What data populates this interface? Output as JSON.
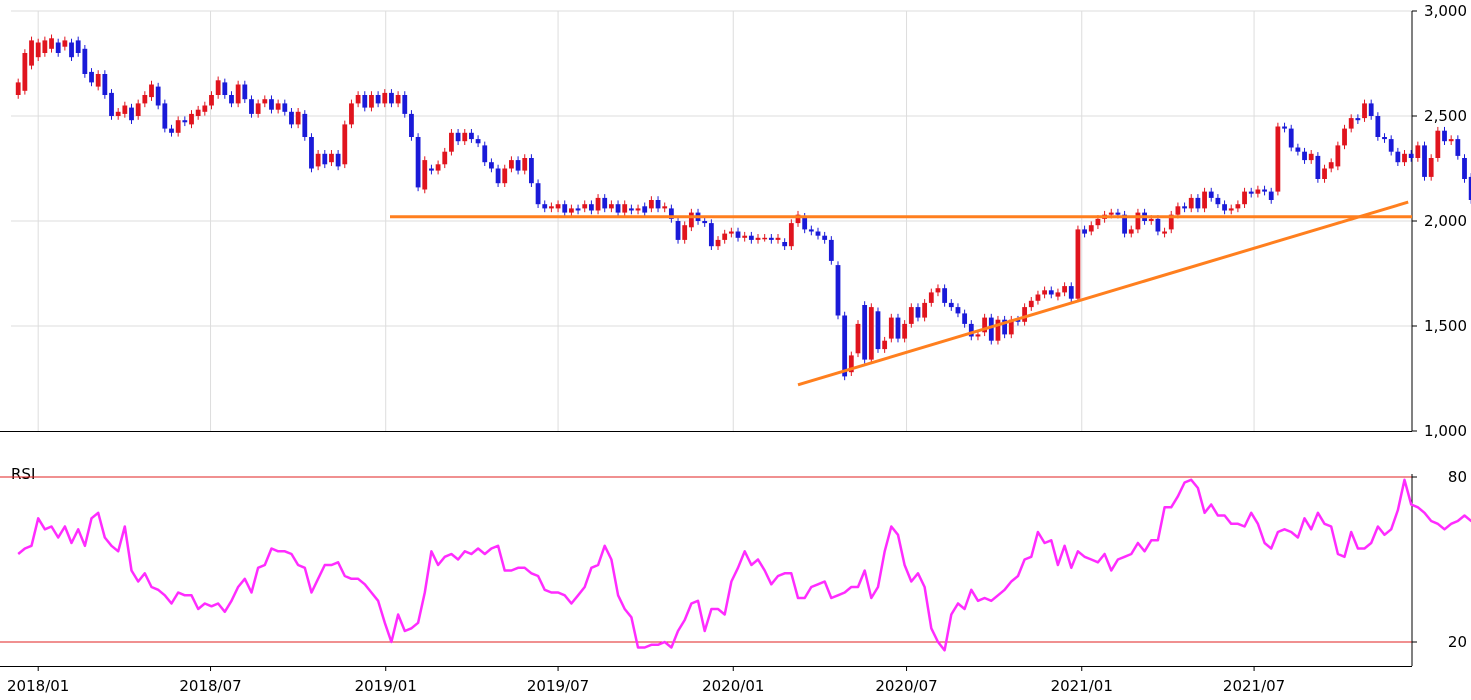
{
  "chart_data": [
    {
      "type": "candlestick",
      "ylim": [
        1000,
        3000
      ],
      "yticks": [
        "3,000",
        "2,500",
        "2,000",
        "1,500",
        "1,000"
      ],
      "ytick_values": [
        3000,
        2500,
        2000,
        1500,
        1000
      ],
      "xticks": [
        "2018/01",
        "2018/07",
        "2019/01",
        "2019/07",
        "2020/01",
        "2020/07",
        "2021/01",
        "2021/07"
      ],
      "grid": true,
      "colors": {
        "up": "#e0141e",
        "down": "#1a1ad8",
        "trend": "#ff7f1e",
        "marker": "#3b3bb0"
      },
      "start_date": "2017-12-11",
      "period": "weekly",
      "candles": [
        [
          2600,
          2660
        ],
        [
          2620,
          2800
        ],
        [
          2740,
          2860
        ],
        [
          2780,
          2850
        ],
        [
          2800,
          2860
        ],
        [
          2820,
          2870
        ],
        [
          2850,
          2800
        ],
        [
          2830,
          2860
        ],
        [
          2850,
          2780
        ],
        [
          2860,
          2800
        ],
        [
          2820,
          2700
        ],
        [
          2710,
          2660
        ],
        [
          2640,
          2700
        ],
        [
          2700,
          2600
        ],
        [
          2610,
          2500
        ],
        [
          2500,
          2520
        ],
        [
          2510,
          2550
        ],
        [
          2540,
          2480
        ],
        [
          2500,
          2560
        ],
        [
          2560,
          2600
        ],
        [
          2590,
          2650
        ],
        [
          2640,
          2550
        ],
        [
          2560,
          2440
        ],
        [
          2440,
          2420
        ],
        [
          2420,
          2480
        ],
        [
          2480,
          2470
        ],
        [
          2460,
          2510
        ],
        [
          2500,
          2530
        ],
        [
          2520,
          2550
        ],
        [
          2550,
          2600
        ],
        [
          2600,
          2670
        ],
        [
          2660,
          2600
        ],
        [
          2600,
          2560
        ],
        [
          2560,
          2650
        ],
        [
          2650,
          2580
        ],
        [
          2580,
          2510
        ],
        [
          2510,
          2560
        ],
        [
          2560,
          2580
        ],
        [
          2580,
          2530
        ],
        [
          2530,
          2560
        ],
        [
          2560,
          2520
        ],
        [
          2520,
          2460
        ],
        [
          2460,
          2520
        ],
        [
          2510,
          2400
        ],
        [
          2400,
          2250
        ],
        [
          2260,
          2320
        ],
        [
          2320,
          2270
        ],
        [
          2280,
          2320
        ],
        [
          2320,
          2260
        ],
        [
          2270,
          2460
        ],
        [
          2460,
          2560
        ],
        [
          2560,
          2600
        ],
        [
          2600,
          2540
        ],
        [
          2540,
          2600
        ],
        [
          2600,
          2560
        ],
        [
          2560,
          2610
        ],
        [
          2610,
          2560
        ],
        [
          2560,
          2600
        ],
        [
          2600,
          2510
        ],
        [
          2510,
          2400
        ],
        [
          2400,
          2160
        ],
        [
          2150,
          2290
        ],
        [
          2250,
          2240
        ],
        [
          2240,
          2270
        ],
        [
          2270,
          2330
        ],
        [
          2330,
          2420
        ],
        [
          2420,
          2380
        ],
        [
          2380,
          2420
        ],
        [
          2420,
          2390
        ],
        [
          2390,
          2370
        ],
        [
          2360,
          2280
        ],
        [
          2280,
          2250
        ],
        [
          2250,
          2180
        ],
        [
          2180,
          2250
        ],
        [
          2250,
          2290
        ],
        [
          2290,
          2240
        ],
        [
          2240,
          2300
        ],
        [
          2300,
          2180
        ],
        [
          2180,
          2080
        ],
        [
          2080,
          2060
        ],
        [
          2060,
          2070
        ],
        [
          2060,
          2080
        ],
        [
          2080,
          2040
        ],
        [
          2040,
          2060
        ],
        [
          2060,
          2050
        ],
        [
          2060,
          2080
        ],
        [
          2080,
          2050
        ],
        [
          2050,
          2110
        ],
        [
          2110,
          2060
        ],
        [
          2060,
          2080
        ],
        [
          2080,
          2040
        ],
        [
          2040,
          2080
        ],
        [
          2060,
          2050
        ],
        [
          2050,
          2060
        ],
        [
          2070,
          2040
        ],
        [
          2060,
          2100
        ],
        [
          2100,
          2060
        ],
        [
          2060,
          2070
        ],
        [
          2060,
          2010
        ],
        [
          2000,
          1910
        ],
        [
          1910,
          1980
        ],
        [
          1970,
          2040
        ],
        [
          2040,
          2000
        ],
        [
          2000,
          1990
        ],
        [
          1990,
          1880
        ],
        [
          1880,
          1910
        ],
        [
          1910,
          1940
        ],
        [
          1940,
          1950
        ],
        [
          1950,
          1920
        ],
        [
          1920,
          1930
        ],
        [
          1930,
          1910
        ],
        [
          1910,
          1920
        ],
        [
          1920,
          1920
        ],
        [
          1920,
          1910
        ],
        [
          1910,
          1920
        ],
        [
          1900,
          1880
        ],
        [
          1880,
          1990
        ],
        [
          1990,
          2030
        ],
        [
          2020,
          1960
        ],
        [
          1960,
          1950
        ],
        [
          1950,
          1930
        ],
        [
          1930,
          1910
        ],
        [
          1910,
          1810
        ],
        [
          1790,
          1550
        ],
        [
          1550,
          1260
        ],
        [
          1280,
          1360
        ],
        [
          1370,
          1510
        ],
        [
          1600,
          1340
        ],
        [
          1340,
          1590
        ],
        [
          1570,
          1390
        ],
        [
          1390,
          1430
        ],
        [
          1440,
          1540
        ],
        [
          1540,
          1440
        ],
        [
          1440,
          1510
        ],
        [
          1510,
          1590
        ],
        [
          1590,
          1540
        ],
        [
          1540,
          1610
        ],
        [
          1610,
          1660
        ],
        [
          1660,
          1680
        ],
        [
          1680,
          1610
        ],
        [
          1610,
          1590
        ],
        [
          1590,
          1560
        ],
        [
          1560,
          1510
        ],
        [
          1510,
          1450
        ],
        [
          1450,
          1460
        ],
        [
          1470,
          1540
        ],
        [
          1540,
          1430
        ],
        [
          1430,
          1530
        ],
        [
          1530,
          1460
        ],
        [
          1460,
          1530
        ],
        [
          1530,
          1520
        ],
        [
          1520,
          1590
        ],
        [
          1590,
          1620
        ],
        [
          1620,
          1650
        ],
        [
          1650,
          1670
        ],
        [
          1670,
          1650
        ],
        [
          1640,
          1660
        ],
        [
          1660,
          1690
        ],
        [
          1690,
          1630
        ],
        [
          1630,
          1960
        ],
        [
          1960,
          1940
        ],
        [
          1950,
          1980
        ],
        [
          1980,
          2010
        ],
        [
          2010,
          2030
        ],
        [
          2030,
          2040
        ],
        [
          2040,
          2030
        ],
        [
          2030,
          1940
        ],
        [
          1940,
          1960
        ],
        [
          1960,
          2040
        ],
        [
          2040,
          2000
        ],
        [
          2000,
          2010
        ],
        [
          2010,
          1950
        ],
        [
          1940,
          1950
        ],
        [
          1960,
          2030
        ],
        [
          2030,
          2070
        ],
        [
          2070,
          2060
        ],
        [
          2060,
          2110
        ],
        [
          2110,
          2060
        ],
        [
          2060,
          2140
        ],
        [
          2140,
          2110
        ],
        [
          2110,
          2080
        ],
        [
          2080,
          2050
        ],
        [
          2050,
          2060
        ],
        [
          2060,
          2080
        ],
        [
          2080,
          2140
        ],
        [
          2140,
          2130
        ],
        [
          2130,
          2150
        ],
        [
          2150,
          2140
        ],
        [
          2140,
          2100
        ],
        [
          2140,
          2450
        ],
        [
          2450,
          2440
        ],
        [
          2440,
          2350
        ],
        [
          2350,
          2330
        ],
        [
          2330,
          2290
        ],
        [
          2290,
          2320
        ],
        [
          2310,
          2200
        ],
        [
          2200,
          2250
        ],
        [
          2250,
          2280
        ],
        [
          2260,
          2360
        ],
        [
          2360,
          2440
        ],
        [
          2440,
          2490
        ],
        [
          2490,
          2480
        ],
        [
          2490,
          2560
        ],
        [
          2560,
          2500
        ],
        [
          2500,
          2400
        ],
        [
          2400,
          2390
        ],
        [
          2390,
          2330
        ],
        [
          2330,
          2280
        ],
        [
          2280,
          2320
        ],
        [
          2320,
          2300
        ],
        [
          2300,
          2360
        ],
        [
          2360,
          2210
        ],
        [
          2210,
          2300
        ],
        [
          2300,
          2430
        ],
        [
          2430,
          2380
        ],
        [
          2380,
          2390
        ],
        [
          2390,
          2310
        ],
        [
          2300,
          2200
        ],
        [
          2210,
          2100
        ],
        [
          2100,
          2180
        ],
        [
          2180,
          2100
        ],
        [
          2100,
          2180
        ],
        [
          2180,
          2200
        ],
        [
          2200,
          2170
        ],
        [
          2170,
          2180
        ]
      ],
      "trend_lines": [
        {
          "kind": "horizontal",
          "price": 2020
        },
        {
          "kind": "rising",
          "from": [
            "2020-03",
            1220
          ],
          "to": [
            "2021-11",
            2090
          ]
        }
      ],
      "current_marker": 2170
    },
    {
      "type": "line",
      "title": "RSI",
      "ylim": [
        20,
        80
      ],
      "reference_lines": [
        80,
        20
      ],
      "yticks": [
        "80",
        "20"
      ],
      "colors": {
        "line": "#ff2cff",
        "reference": "#e02020"
      },
      "series": [
        {
          "values": [
            52,
            54,
            55,
            65,
            61,
            62,
            58,
            62,
            56,
            61,
            55,
            65,
            67,
            58,
            55,
            53,
            62,
            46,
            42,
            45,
            40,
            39,
            37,
            34,
            38,
            37,
            37,
            32,
            34,
            33,
            34,
            31,
            35,
            40,
            43,
            38,
            47,
            48,
            54,
            53,
            53,
            52,
            48,
            47,
            38,
            43,
            48,
            48,
            49,
            44,
            43,
            43,
            41,
            38,
            35,
            27,
            20,
            30,
            24,
            25,
            27,
            38,
            53,
            48,
            51,
            52,
            50,
            53,
            52,
            54,
            52,
            54,
            55,
            46,
            46,
            47,
            47,
            45,
            44,
            39,
            38,
            38,
            37,
            34,
            37,
            40,
            47,
            48,
            55,
            50,
            37,
            32,
            29,
            18,
            18,
            19,
            19,
            20,
            18,
            24,
            28,
            34,
            35,
            24,
            32,
            32,
            30,
            42,
            47,
            53,
            48,
            50,
            46,
            41,
            44,
            45,
            45,
            36,
            36,
            40,
            41,
            42,
            36,
            37,
            38,
            40,
            40,
            46,
            36,
            40,
            53,
            62,
            59,
            48,
            42,
            45,
            40,
            25,
            20,
            17,
            30,
            34,
            32,
            39,
            35,
            36,
            35,
            37,
            39,
            42,
            44,
            50,
            51,
            60,
            56,
            57,
            48,
            55,
            47,
            53,
            51,
            50,
            49,
            52,
            46,
            50,
            51,
            52,
            56,
            53,
            57,
            57,
            69,
            69,
            73,
            78,
            79,
            76,
            67,
            70,
            66,
            66,
            63,
            63,
            62,
            67,
            63,
            56,
            54,
            60,
            61,
            60,
            58,
            65,
            61,
            67,
            63,
            62,
            52,
            51,
            60,
            54,
            54,
            56,
            62,
            59,
            61,
            68,
            79,
            70,
            69,
            67,
            64,
            63,
            61,
            63,
            64,
            66,
            64,
            63,
            66,
            66,
            62,
            54,
            48,
            53,
            47,
            49,
            49,
            50,
            49,
            52,
            48,
            54,
            52,
            55,
            50,
            45,
            38,
            35,
            32,
            37,
            39,
            40,
            42
          ]
        }
      ],
      "xticks": [
        "2018/01",
        "2018/07",
        "2019/01",
        "2019/07",
        "2020/01",
        "2020/07",
        "2021/01",
        "2021/07"
      ]
    }
  ]
}
